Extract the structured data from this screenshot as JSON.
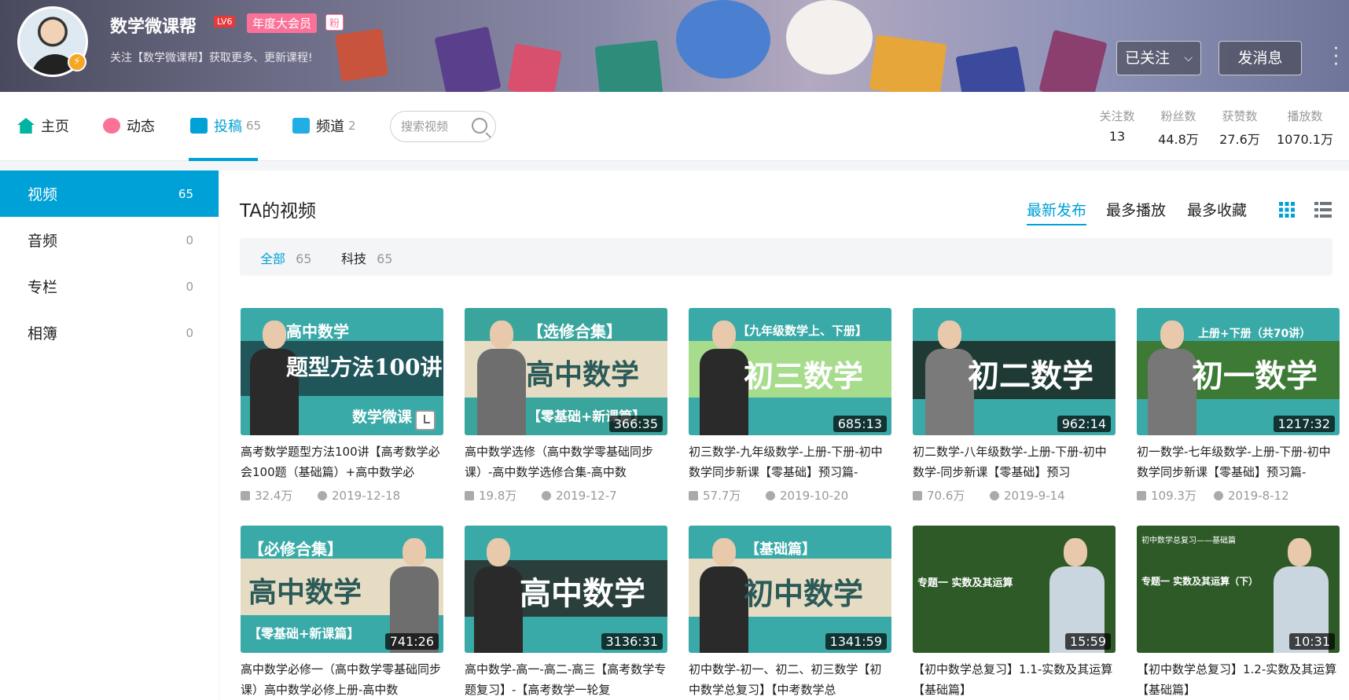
{
  "header": {
    "username": "数学微课帮",
    "level": "LV6",
    "vip_label": "年度大会员",
    "fan_badge": "粉",
    "sign": "关注【数学微课帮】获取更多、更新课程!",
    "follow_button": "已关注",
    "message_button": "发消息"
  },
  "nav": {
    "tabs": [
      {
        "label": "主页",
        "count": ""
      },
      {
        "label": "动态",
        "count": ""
      },
      {
        "label": "投稿",
        "count": "65"
      },
      {
        "label": "频道",
        "count": "2"
      }
    ],
    "search_placeholder": "搜索视频",
    "stats": [
      {
        "label": "关注数",
        "value": "13"
      },
      {
        "label": "粉丝数",
        "value": "44.8万"
      },
      {
        "label": "获赞数",
        "value": "27.6万"
      },
      {
        "label": "播放数",
        "value": "1070.1万"
      }
    ]
  },
  "sidebar": {
    "items": [
      {
        "label": "视频",
        "count": "65"
      },
      {
        "label": "音频",
        "count": "0"
      },
      {
        "label": "专栏",
        "count": "0"
      },
      {
        "label": "相簿",
        "count": "0"
      }
    ]
  },
  "main": {
    "title": "TA的视频",
    "sort": [
      "最新发布",
      "最多播放",
      "最多收藏"
    ],
    "filters": [
      {
        "label": "全部",
        "count": "65"
      },
      {
        "label": "科技",
        "count": "65"
      }
    ],
    "videos": [
      {
        "thumb_top": "高中数学",
        "thumb_big": "题型方法100讲",
        "thumb_bottom": "数学微课",
        "duration": "",
        "title": "高考数学题型方法100讲【高考数学必会100题（基础篇）+高中数学必",
        "plays": "32.4万",
        "date": "2019-12-18"
      },
      {
        "thumb_top": "【选修合集】",
        "thumb_big": "高中数学",
        "thumb_bottom": "【零基础+新课篇】",
        "duration": "366:35",
        "title": "高中数学选修（高中数学零基础同步课）-高中数学选修合集-高中数",
        "plays": "19.8万",
        "date": "2019-12-7"
      },
      {
        "thumb_top": "【九年级数学上、下册】",
        "thumb_big": "初三数学",
        "thumb_bottom": "",
        "duration": "685:13",
        "title": "初三数学-九年级数学-上册-下册-初中数学同步新课【零基础】预习篇-",
        "plays": "57.7万",
        "date": "2019-10-20"
      },
      {
        "thumb_top": "",
        "thumb_big": "初二数学",
        "thumb_bottom": "",
        "duration": "962:14",
        "title": "初二数学-八年级数学-上册-下册-初中数学-同步新课【零基础】预习",
        "plays": "70.6万",
        "date": "2019-9-14"
      },
      {
        "thumb_top": "上册+下册（共70讲）",
        "thumb_big": "初一数学",
        "thumb_bottom": "",
        "duration": "1217:32",
        "title": "初一数学-七年级数学-上册-下册-初中数学同步新课【零基础】预习篇-",
        "plays": "109.3万",
        "date": "2019-8-12"
      },
      {
        "thumb_top": "【必修合集】",
        "thumb_big": "高中数学",
        "thumb_bottom": "【零基础+新课篇】",
        "duration": "741:26",
        "title": "高中数学必修一（高中数学零基础同步课）高中数学必修上册-高中数",
        "plays": "",
        "date": ""
      },
      {
        "thumb_top": "",
        "thumb_big": "高中数学",
        "thumb_bottom": "",
        "duration": "3136:31",
        "title": "高中数学-高一-高二-高三【高考数学专题复习】-【高考数学一轮复",
        "plays": "",
        "date": ""
      },
      {
        "thumb_top": "【基础篇】",
        "thumb_big": "初中数学",
        "thumb_bottom": "",
        "duration": "1341:59",
        "title": "初中数学-初一、初二、初三数学【初中数学总复习】【中考数学总",
        "plays": "",
        "date": ""
      },
      {
        "thumb_top": "",
        "thumb_big": "专题一 实数及其运算",
        "thumb_bottom": "",
        "duration": "15:59",
        "title": "【初中数学总复习】1.1-实数及其运算【基础篇】",
        "plays": "",
        "date": ""
      },
      {
        "thumb_top": "初中数学总复习——基础篇",
        "thumb_big": "专题一 实数及其运算（下）",
        "thumb_bottom": "",
        "duration": "10:31",
        "title": "【初中数学总复习】1.2-实数及其运算【基础篇】",
        "plays": "",
        "date": ""
      }
    ]
  },
  "colors": {
    "accent": "#00a1d6",
    "vip": "#fb7299",
    "teal": "#3aaaa8"
  }
}
